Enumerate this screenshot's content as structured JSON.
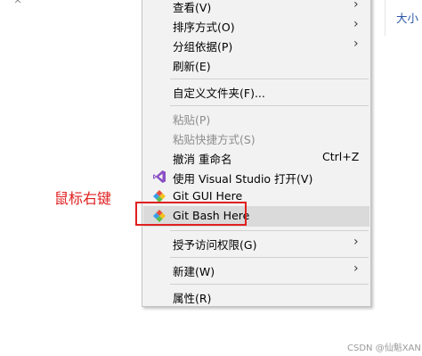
{
  "explorer": {
    "up_arrow": "^",
    "column_header": "大小"
  },
  "context_menu": {
    "view": "查看(V)",
    "sort_by": "排序方式(O)",
    "group_by": "分组依据(P)",
    "refresh": "刷新(E)",
    "customize_folder": "自定义文件夹(F)...",
    "paste": "粘贴(P)",
    "paste_shortcut": "粘贴快捷方式(S)",
    "undo_rename": "撤消 重命名",
    "undo_shortcut": "Ctrl+Z",
    "open_with_vs": "使用 Visual Studio 打开(V)",
    "git_gui": "Git GUI Here",
    "git_bash": "Git Bash Here",
    "give_access": "授予访问权限(G)",
    "new": "新建(W)",
    "properties": "属性(R)",
    "submenu_arrow": "›"
  },
  "annotation": {
    "text": "鼠标右键"
  },
  "watermark": "CSDN @仙魁XAN",
  "colors": {
    "menu_bg": "#f2f2f2",
    "highlight": "#dadada",
    "annotation_red": "#e02020",
    "vs_purple": "#8a4fc4"
  },
  "icons": {
    "visual_studio": "visual-studio-icon",
    "git_gui": "git-gui-icon",
    "git_bash": "git-bash-icon"
  }
}
